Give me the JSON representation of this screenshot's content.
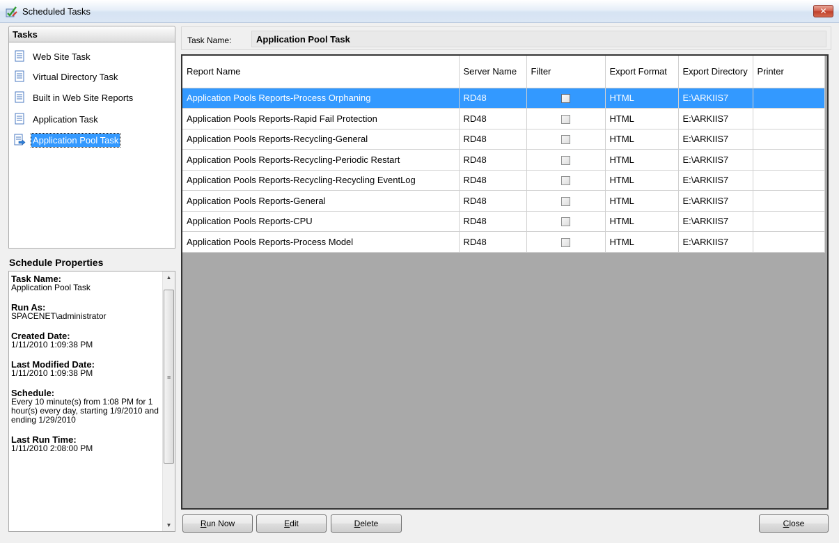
{
  "window": {
    "title": "Scheduled Tasks",
    "close_label": "✕"
  },
  "tasks": {
    "header": "Tasks",
    "items": [
      {
        "label": "Web Site Task",
        "selected": false
      },
      {
        "label": "Virtual Directory Task",
        "selected": false
      },
      {
        "label": "Built in Web Site Reports",
        "selected": false
      },
      {
        "label": "Application Task",
        "selected": false
      },
      {
        "label": "Application Pool Task",
        "selected": true
      }
    ]
  },
  "schedule": {
    "header": "Schedule Properties",
    "fields": [
      {
        "label": "Task Name:",
        "value": "Application Pool Task"
      },
      {
        "label": "Run As:",
        "value": "SPACENET\\administrator"
      },
      {
        "label": "Created Date:",
        "value": "1/11/2010 1:09:38 PM"
      },
      {
        "label": "Last Modified Date:",
        "value": "1/11/2010 1:09:38 PM"
      },
      {
        "label": "Schedule:",
        "value": "Every 10 minute(s) from 1:08 PM for 1 hour(s) every day, starting 1/9/2010 and ending 1/29/2010"
      },
      {
        "label": "Last Run Time:",
        "value": "1/11/2010 2:08:00 PM"
      }
    ]
  },
  "task_name": {
    "label": "Task Name:",
    "value": "Application Pool Task"
  },
  "grid": {
    "columns": [
      {
        "label": "Report Name"
      },
      {
        "label": "Server Name"
      },
      {
        "label": "Filter"
      },
      {
        "label": "Export Format"
      },
      {
        "label": "Export Directory"
      },
      {
        "label": "Printer"
      }
    ],
    "rows": [
      {
        "report": "Application Pools Reports-Process Orphaning",
        "server": "RD48",
        "filter": false,
        "format": "HTML",
        "directory": "E:\\ARKIIS7",
        "printer": "",
        "selected": true
      },
      {
        "report": "Application Pools Reports-Rapid Fail Protection",
        "server": "RD48",
        "filter": false,
        "format": "HTML",
        "directory": "E:\\ARKIIS7",
        "printer": "",
        "selected": false
      },
      {
        "report": "Application Pools Reports-Recycling-General",
        "server": "RD48",
        "filter": false,
        "format": "HTML",
        "directory": "E:\\ARKIIS7",
        "printer": "",
        "selected": false
      },
      {
        "report": "Application Pools Reports-Recycling-Periodic Restart",
        "server": "RD48",
        "filter": false,
        "format": "HTML",
        "directory": "E:\\ARKIIS7",
        "printer": "",
        "selected": false
      },
      {
        "report": "Application Pools Reports-Recycling-Recycling EventLog",
        "server": "RD48",
        "filter": false,
        "format": "HTML",
        "directory": "E:\\ARKIIS7",
        "printer": "",
        "selected": false
      },
      {
        "report": "Application Pools Reports-General",
        "server": "RD48",
        "filter": false,
        "format": "HTML",
        "directory": "E:\\ARKIIS7",
        "printer": "",
        "selected": false
      },
      {
        "report": "Application Pools Reports-CPU",
        "server": "RD48",
        "filter": false,
        "format": "HTML",
        "directory": "E:\\ARKIIS7",
        "printer": "",
        "selected": false
      },
      {
        "report": "Application Pools Reports-Process Model",
        "server": "RD48",
        "filter": false,
        "format": "HTML",
        "directory": "E:\\ARKIIS7",
        "printer": "",
        "selected": false
      }
    ]
  },
  "buttons": {
    "run_now": {
      "label": "Run Now",
      "mnemonic": "R",
      "rest": "un Now"
    },
    "edit": {
      "label": "Edit",
      "mnemonic": "E",
      "rest": "dit"
    },
    "delete": {
      "label": "Delete",
      "mnemonic": "D",
      "rest": "elete"
    },
    "close": {
      "label": "Close",
      "mnemonic": "C",
      "rest": "lose"
    }
  },
  "colors": {
    "selection": "#3399ff",
    "grid_background": "#a9a9a9",
    "window_background": "#f0f0f0"
  }
}
